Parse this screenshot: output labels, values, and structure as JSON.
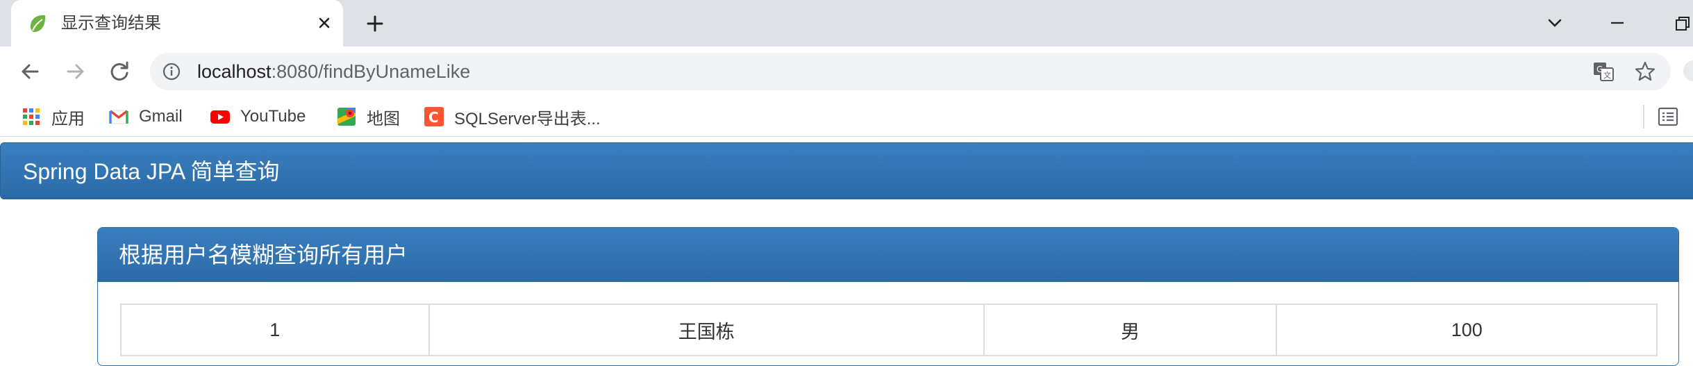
{
  "browser": {
    "tab": {
      "title": "显示查询结果",
      "favicon": "spring-leaf-icon"
    },
    "address_bar": {
      "host": "localhost",
      "rest": ":8080/findByUnameLike"
    },
    "bookmarks": [
      {
        "label": "应用",
        "icon": "apps-grid-icon"
      },
      {
        "label": "Gmail",
        "icon": "gmail-icon"
      },
      {
        "label": "YouTube",
        "icon": "youtube-icon"
      },
      {
        "label": "地图",
        "icon": "maps-icon"
      },
      {
        "label": "SQLServer导出表...",
        "icon": "csdn-icon"
      }
    ]
  },
  "page": {
    "navbar_brand": "Spring Data JPA 简单查询",
    "panel_title": "根据用户名模糊查询所有用户",
    "rows": [
      {
        "id": "1",
        "name": "王国栋",
        "sex": "男",
        "score": "100"
      }
    ]
  },
  "colors": {
    "primary": "#337ab7",
    "tabstrip": "#dee1e6",
    "omnibox": "#f1f3f4"
  }
}
